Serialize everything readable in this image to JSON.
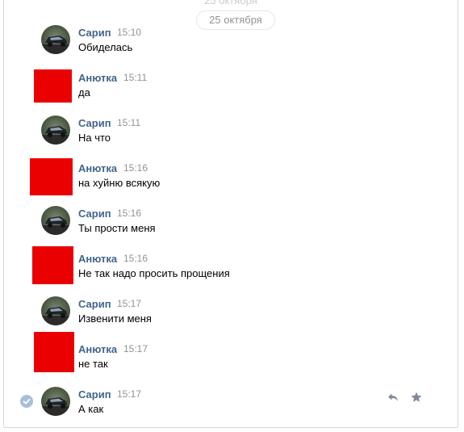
{
  "date_header": {
    "label": "25 октября",
    "ghost_label": "25 октября"
  },
  "messages": [
    {
      "author": "Сарип",
      "time": "15:10",
      "text": "Обиделась"
    },
    {
      "author": "Анютка",
      "time": "15:11",
      "text": "да"
    },
    {
      "author": "Сарип",
      "time": "15:11",
      "text": "На что"
    },
    {
      "author": "Анютка",
      "time": "15:16",
      "text": "на хуйню всякую"
    },
    {
      "author": "Сарип",
      "time": "15:16",
      "text": "Ты прости меня"
    },
    {
      "author": "Анютка",
      "time": "15:16",
      "text": "Не так надо просить прощения"
    },
    {
      "author": "Сарип",
      "time": "15:17",
      "text": "Извенити меня"
    },
    {
      "author": "Анютка",
      "time": "15:17",
      "text": "не так"
    },
    {
      "author": "Сарип",
      "time": "15:17",
      "text": "А как"
    }
  ],
  "colors": {
    "author": "#42648b",
    "avatar_red": "#ea0000",
    "check": "#a8bfd8",
    "icon": "#828a99"
  },
  "icons": {
    "reply": "reply-icon",
    "favorite": "star-icon",
    "selected": "check-circle-icon"
  }
}
